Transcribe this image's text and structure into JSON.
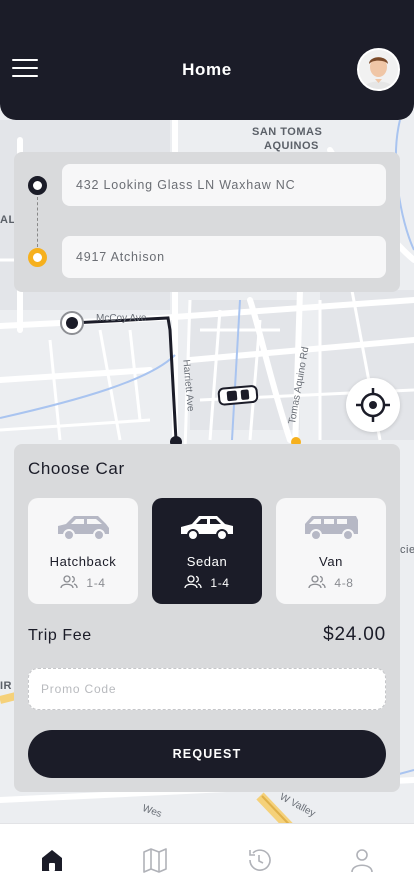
{
  "header": {
    "title": "Home",
    "menu_icon": "hamburger-menu-icon",
    "avatar_icon": "user-avatar"
  },
  "map": {
    "labels": [
      "SAN TOMAS",
      "AQUINOS",
      "AL",
      "IR",
      "cie"
    ],
    "streets": [
      "McCoy Ave",
      "Harriett Ave",
      "Tomas Aquino Rd",
      "W Valley",
      "Wes"
    ],
    "route_color": "#1b1c28",
    "destination_color": "#f6b01d"
  },
  "route": {
    "origin": "432 Looking Glass LN Waxhaw NC",
    "destination": "4917 Atchison"
  },
  "choose_car": {
    "title": "Choose Car",
    "cars": [
      {
        "name": "Hatchback",
        "seats": "1-4",
        "selected": false
      },
      {
        "name": "Sedan",
        "seats": "1-4",
        "selected": true
      },
      {
        "name": "Van",
        "seats": "4-8",
        "selected": false
      }
    ]
  },
  "trip": {
    "fee_label": "Trip Fee",
    "fee_value": "$24.00",
    "promo_placeholder": "Promo Code",
    "request_label": "REQUEST"
  },
  "bottom_nav": {
    "items": [
      "home-icon",
      "map-icon",
      "history-icon",
      "profile-icon"
    ],
    "active": "home-icon"
  },
  "colors": {
    "primary": "#1b1c28",
    "accent": "#f6b01d",
    "panel": "#d9dadc"
  }
}
